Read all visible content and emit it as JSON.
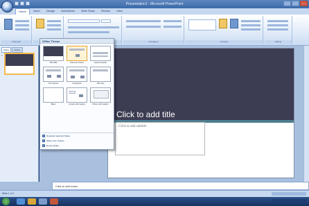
{
  "window": {
    "title": "Presentation1 - Microsoft PowerPoint"
  },
  "ribbon": {
    "tabs": [
      "Home",
      "Insert",
      "Design",
      "Animations",
      "Slide Show",
      "Review",
      "View"
    ],
    "groups": [
      "Clipboard",
      "Slides",
      "Font",
      "Paragraph",
      "Drawing",
      "Editing"
    ]
  },
  "left_panel": {
    "tabs": [
      "Slides",
      "Outline"
    ],
    "slide_number": "1"
  },
  "layout_menu": {
    "header": "Office Theme",
    "layouts": [
      "Title Slide",
      "Title and Content",
      "Section Header",
      "Two Content",
      "Comparison",
      "Title Only",
      "Blank",
      "Content with Caption",
      "Picture with Caption"
    ],
    "commands": [
      "Duplicate Selected Slides",
      "Slides from Outline...",
      "Reuse Slides..."
    ]
  },
  "slide": {
    "title_placeholder": "Click to add title",
    "subtitle_placeholder": "Click to add subtitle"
  },
  "notes": {
    "placeholder": "Click to add notes"
  },
  "status": {
    "left": "Slide 1 of 1"
  },
  "colors": {
    "accent": "#3c3c52",
    "band": "#4f7e8f",
    "ribbon": "#c5d8f0"
  }
}
